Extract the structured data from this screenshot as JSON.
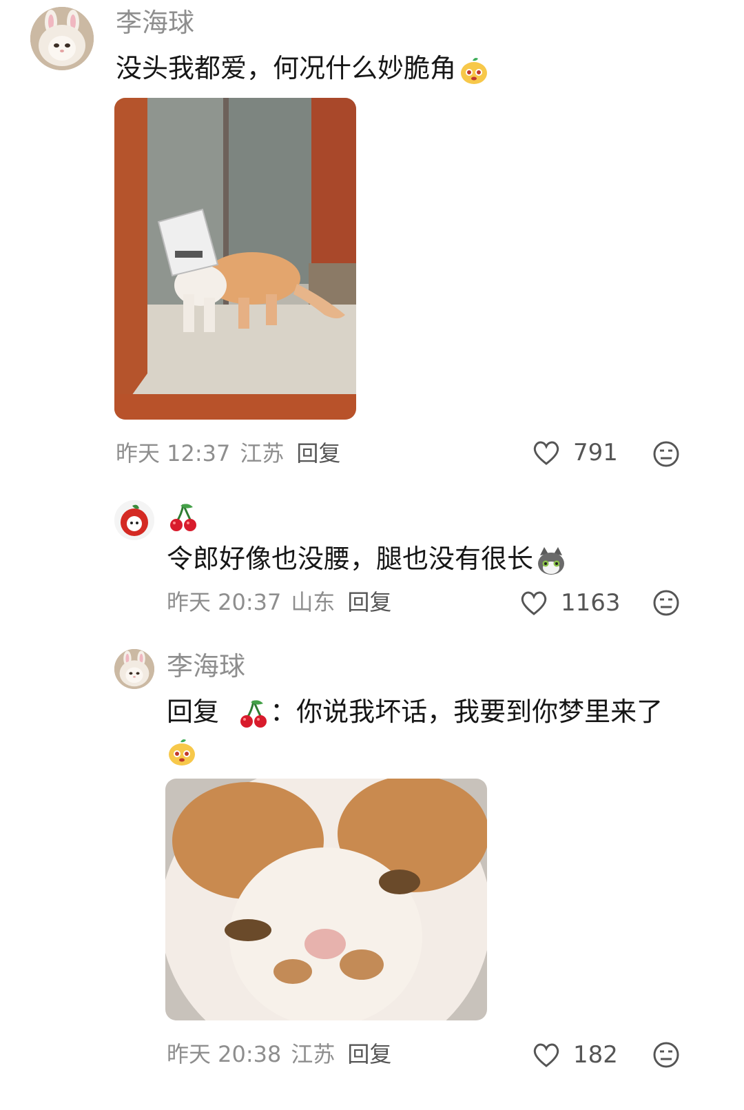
{
  "comments": [
    {
      "username": "李海球",
      "text": "没头我都爱，何况什么妙脆角",
      "emoji": "orange-mascot-emoji",
      "time": "昨天 12:37",
      "location": "江苏",
      "reply_label": "回复",
      "likes": "791"
    },
    {
      "username_icon": "cherry-emoji",
      "text": "令郎好像也没腰，腿也没有很长",
      "emoji": "gray-cat-emoji",
      "time": "昨天 20:37",
      "location": "山东",
      "reply_label": "回复",
      "likes": "1163"
    },
    {
      "username": "李海球",
      "reply_prefix": "回复",
      "reply_separator": "：",
      "text": "你说我坏话，我要到你梦里来了",
      "emoji": "orange-mascot-emoji",
      "time": "昨天 20:38",
      "location": "江苏",
      "reply_label": "回复",
      "likes": "182"
    }
  ],
  "colors": {
    "text": "#161616",
    "muted": "#8e8e8e",
    "background": "#ffffff"
  }
}
